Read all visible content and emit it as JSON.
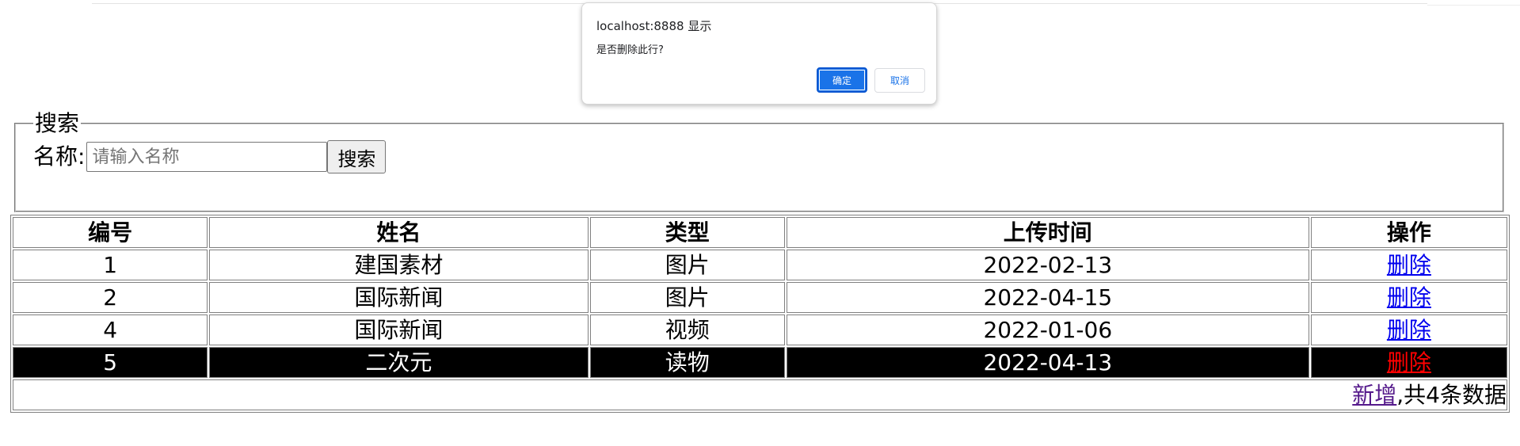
{
  "dialog": {
    "title": "localhost:8888 显示",
    "message": "是否删除此行?",
    "ok_label": "确定",
    "cancel_label": "取消"
  },
  "search": {
    "legend": "搜索",
    "label": "名称:",
    "placeholder": "请输入名称",
    "value": "",
    "button_label": "搜索"
  },
  "table": {
    "headers": [
      "编号",
      "姓名",
      "类型",
      "上传时间",
      "操作"
    ],
    "rows": [
      {
        "id": "1",
        "name": "建国素材",
        "type": "图片",
        "date": "2022-02-13",
        "action": "删除"
      },
      {
        "id": "2",
        "name": "国际新闻",
        "type": "图片",
        "date": "2022-04-15",
        "action": "删除"
      },
      {
        "id": "4",
        "name": "国际新闻",
        "type": "视频",
        "date": "2022-01-06",
        "action": "删除"
      },
      {
        "id": "5",
        "name": "二次元",
        "type": "读物",
        "date": "2022-04-13",
        "action": "删除"
      }
    ],
    "footer": {
      "add_label": "新增",
      "count_text": ",共4条数据"
    }
  },
  "colors": {
    "highlight_row_bg": "#000000",
    "highlight_row_text": "#ffffff",
    "highlight_link": "#ff0000",
    "link": "#0000ee",
    "visited_link": "#551a8b",
    "dialog_primary": "#1a73e8"
  }
}
